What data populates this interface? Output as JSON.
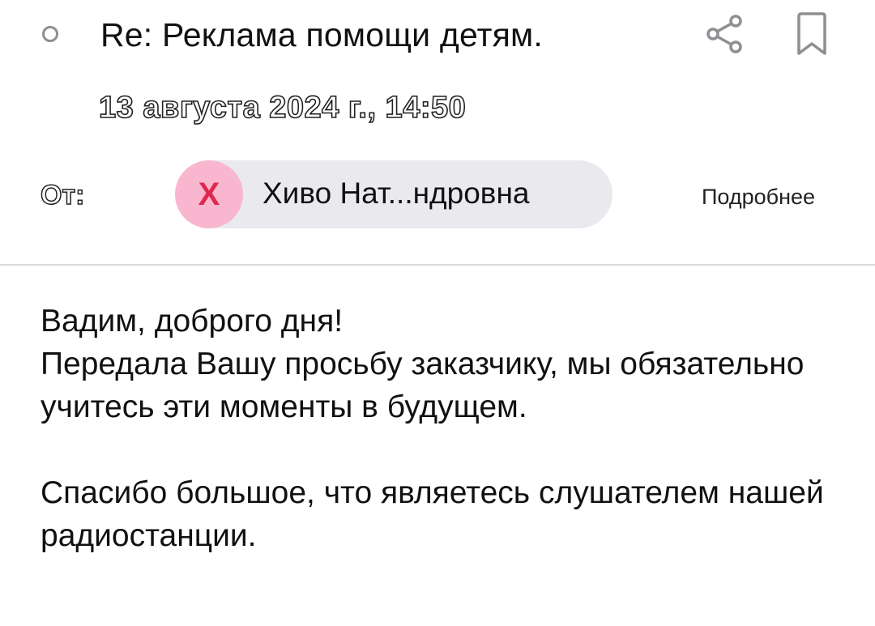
{
  "email": {
    "subject": "Re: Реклама помощи детям.",
    "date": "13 августа 2024 г., 14:50",
    "from_label": "От:",
    "sender": {
      "initial": "Х",
      "name": "Хиво Нат...ндровна",
      "avatar_color": "#f8b7cf",
      "initial_color": "#e0284e"
    },
    "details_label": "Подробнее",
    "body": {
      "line1": "Вадим, доброго дня!",
      "para1": "Передала Вашу просьбу заказчику, мы обязательно учитесь эти моменты в будущем.",
      "para2": "Спасибо большое, что являетесь слушателем нашей радиостанции."
    }
  },
  "icons": {
    "unread": "unread-dot-icon",
    "share": "share-icon",
    "bookmark": "bookmark-icon"
  }
}
